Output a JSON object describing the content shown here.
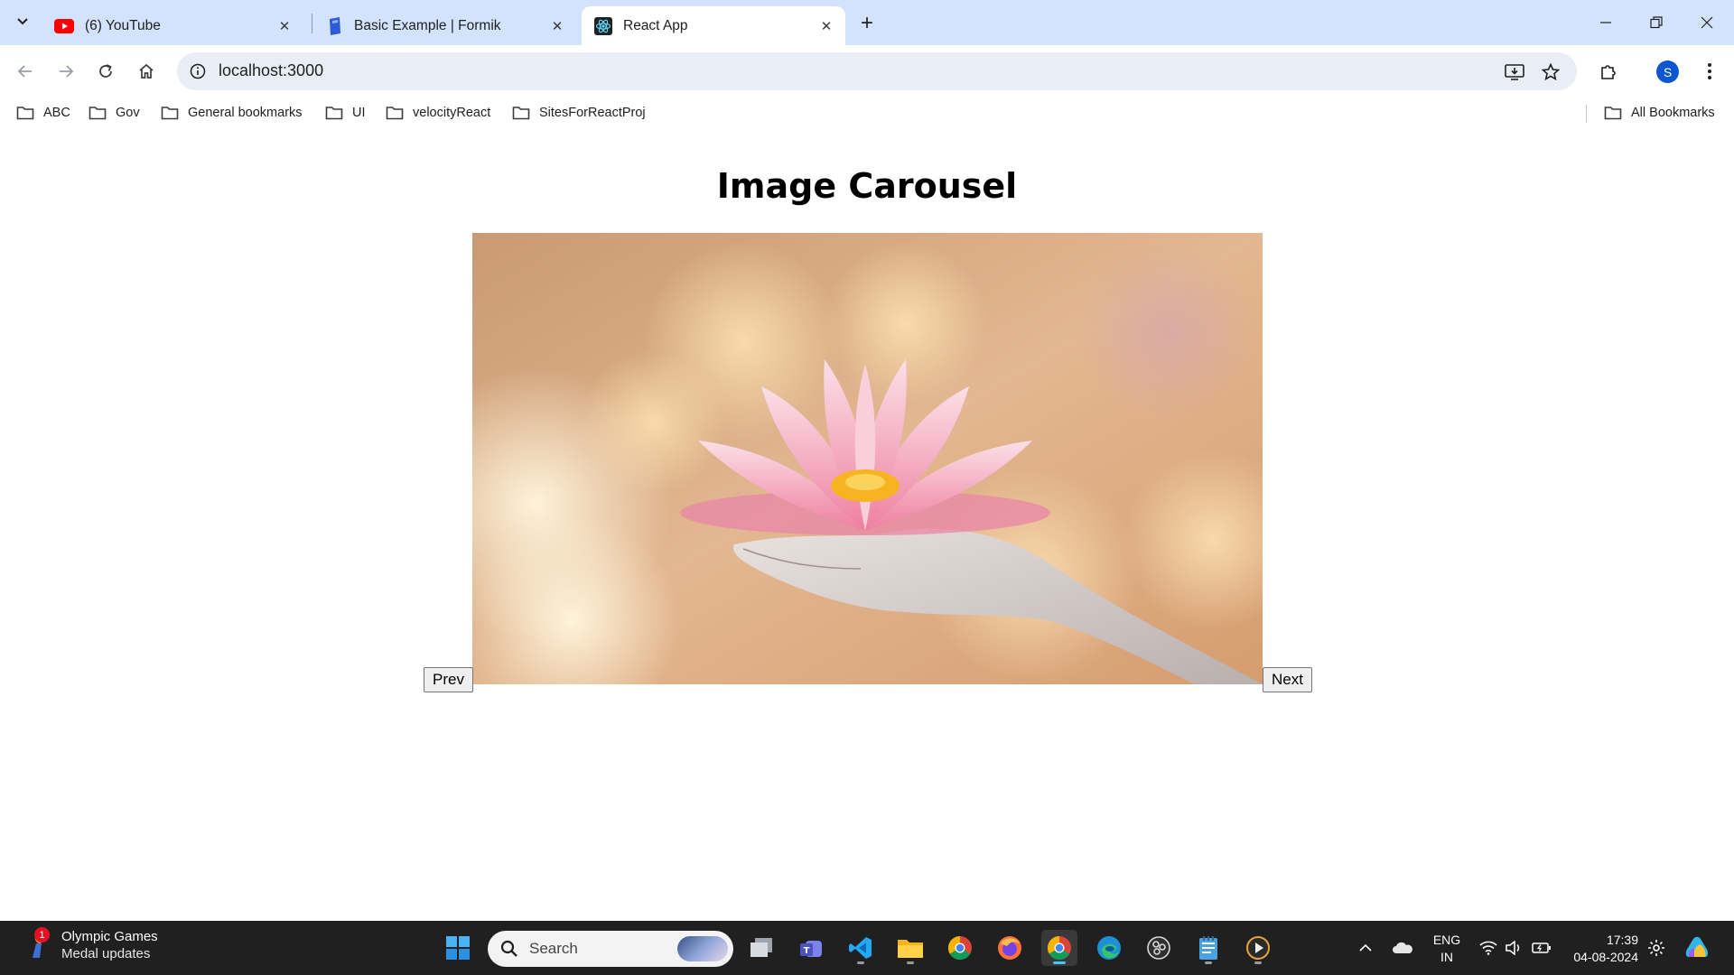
{
  "browser": {
    "tabs": [
      {
        "title": "(6) YouTube",
        "active": false
      },
      {
        "title": "Basic Example | Formik",
        "active": false
      },
      {
        "title": "React App",
        "active": true
      }
    ],
    "address": "localhost:3000",
    "profile_initial": "S",
    "bookmarks": [
      "ABC",
      "Gov",
      "General bookmarks",
      "UI",
      "velocityReact",
      "SitesForReactProj"
    ],
    "all_bookmarks": "All Bookmarks"
  },
  "page": {
    "heading": "Image Carousel",
    "prev_label": "Prev",
    "next_label": "Next",
    "image_icon": "lotus-flower-in-hand-photo"
  },
  "taskbar": {
    "widget_title": "Olympic Games",
    "widget_subtitle": "Medal updates",
    "widget_badge": "1",
    "search_label": "Search",
    "lang_line1": "ENG",
    "lang_line2": "IN",
    "time": "17:39",
    "date": "04-08-2024"
  },
  "colors": {
    "tabstrip": "#d3e3fd",
    "omnibox": "#e9eef6",
    "taskbar": "#202020",
    "accent": "#0b57d0"
  }
}
